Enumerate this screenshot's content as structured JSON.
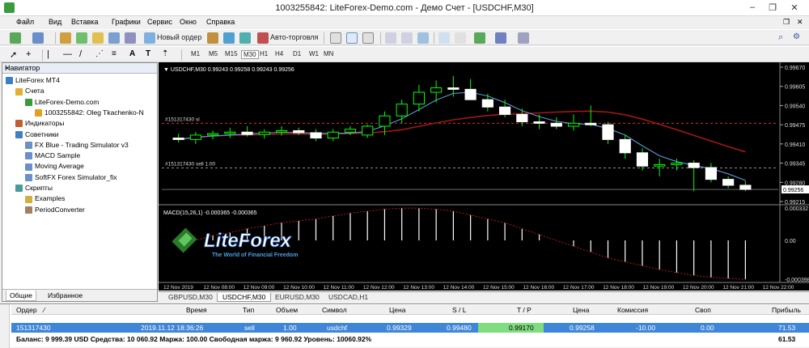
{
  "window": {
    "title": "1003255842: LiteForex-Demo.com - Демо Счет - [USDCHF,M30]",
    "buttons": [
      "–",
      "❐",
      "✕"
    ]
  },
  "menu": [
    "Файл",
    "Вид",
    "Вставка",
    "Графики",
    "Сервис",
    "Окно",
    "Справка"
  ],
  "toolbar": {
    "new_order": "Новый ордер",
    "auto_trading": "Авто-торговля",
    "timeframes": [
      "M1",
      "M5",
      "M15",
      "M30",
      "H1",
      "H4",
      "D1",
      "W1",
      "MN"
    ]
  },
  "navigator": {
    "title": "Навигатор",
    "items": [
      {
        "label": "LiteForex MT4",
        "level": 0,
        "icon": "terminal-icon"
      },
      {
        "label": "Счета",
        "level": 1,
        "icon": "accounts-icon"
      },
      {
        "label": "LiteForex-Demo.com",
        "level": 2,
        "icon": "server-icon"
      },
      {
        "label": "1003255842: Oleg Tkachenko-N",
        "level": 3,
        "icon": "user-icon"
      },
      {
        "label": "Индикаторы",
        "level": 1,
        "icon": "indicators-icon"
      },
      {
        "label": "Советники",
        "level": 1,
        "icon": "experts-icon"
      },
      {
        "label": "FX Blue - Trading Simulator v3",
        "level": 2,
        "icon": "expert-icon"
      },
      {
        "label": "MACD Sample",
        "level": 2,
        "icon": "expert-icon"
      },
      {
        "label": "Moving Average",
        "level": 2,
        "icon": "expert-icon"
      },
      {
        "label": "SoftFX Forex Simulator_fix",
        "level": 2,
        "icon": "expert-icon"
      },
      {
        "label": "Скрипты",
        "level": 1,
        "icon": "scripts-icon"
      },
      {
        "label": "Examples",
        "level": 2,
        "icon": "folder-icon"
      },
      {
        "label": "PeriodConverter",
        "level": 2,
        "icon": "script-icon"
      }
    ],
    "tabs": [
      "Общие",
      "Избранное"
    ]
  },
  "chart": {
    "header": "USDCHF,M30  0.99243 0.99258 0.99243 0.99256",
    "macd_header": "MACD(15,26,1) -0.000365 -0.000365",
    "order_label_1": "#151317430 sl",
    "order_label_2": "#151317430 sell 1.00",
    "price_ticks": [
      "0.99670",
      "0.99605",
      "0.99540",
      "0.99475",
      "0.99410",
      "0.99345",
      "0.99280",
      "0.99215"
    ],
    "current_price": "0.99256",
    "macd_ticks": [
      "0.000332",
      "0.00",
      "-0.000398"
    ],
    "time_labels": [
      "12 Nov 2019",
      "12 Nov 08:00",
      "12 Nov 09:00",
      "12 Nov 10:00",
      "12 Nov 11:00",
      "12 Nov 12:00",
      "12 Nov 13:00",
      "12 Nov 14:00",
      "12 Nov 15:00",
      "12 Nov 16:00",
      "12 Nov 17:00",
      "12 Nov 18:00",
      "12 Nov 19:00",
      "12 Nov 20:00",
      "12 Nov 21:00",
      "12 Nov 22:00"
    ],
    "logo_name": "LiteForex",
    "logo_tagline": "The World of Financial Freedom",
    "colors": {
      "bg": "#000000",
      "bull": "#ffffff",
      "bear": "#ffffff",
      "wick": "#00ff00",
      "ma_blue": "#5b9bd5",
      "ma_red": "#8b0000",
      "grid": "#444444"
    }
  },
  "chart_data": {
    "type": "candlestick",
    "ylim": [
      0.99215,
      0.9967
    ],
    "candles": [
      {
        "o": 0.9943,
        "h": 0.99445,
        "l": 0.99415,
        "c": 0.99425
      },
      {
        "o": 0.99425,
        "h": 0.9945,
        "l": 0.9941,
        "c": 0.9944
      },
      {
        "o": 0.9944,
        "h": 0.99455,
        "l": 0.99425,
        "c": 0.99445
      },
      {
        "o": 0.99445,
        "h": 0.99465,
        "l": 0.9943,
        "c": 0.9945
      },
      {
        "o": 0.9945,
        "h": 0.9947,
        "l": 0.99435,
        "c": 0.99442
      },
      {
        "o": 0.99442,
        "h": 0.9946,
        "l": 0.99428,
        "c": 0.9945
      },
      {
        "o": 0.9945,
        "h": 0.9947,
        "l": 0.99438,
        "c": 0.99455
      },
      {
        "o": 0.99455,
        "h": 0.99465,
        "l": 0.9944,
        "c": 0.99448
      },
      {
        "o": 0.99448,
        "h": 0.9946,
        "l": 0.9942,
        "c": 0.9943
      },
      {
        "o": 0.9943,
        "h": 0.9946,
        "l": 0.9942,
        "c": 0.9945
      },
      {
        "o": 0.9945,
        "h": 0.9947,
        "l": 0.9944,
        "c": 0.9946
      },
      {
        "o": 0.9944,
        "h": 0.99475,
        "l": 0.9943,
        "c": 0.9947
      },
      {
        "o": 0.9947,
        "h": 0.9952,
        "l": 0.9944,
        "c": 0.99505
      },
      {
        "o": 0.99505,
        "h": 0.9956,
        "l": 0.9948,
        "c": 0.99545
      },
      {
        "o": 0.99545,
        "h": 0.9961,
        "l": 0.9952,
        "c": 0.99585
      },
      {
        "o": 0.99585,
        "h": 0.99625,
        "l": 0.9955,
        "c": 0.996
      },
      {
        "o": 0.996,
        "h": 0.9964,
        "l": 0.9957,
        "c": 0.99595
      },
      {
        "o": 0.99595,
        "h": 0.9963,
        "l": 0.9956,
        "c": 0.9956
      },
      {
        "o": 0.9956,
        "h": 0.9958,
        "l": 0.9952,
        "c": 0.99535
      },
      {
        "o": 0.99535,
        "h": 0.9956,
        "l": 0.995,
        "c": 0.9951
      },
      {
        "o": 0.9951,
        "h": 0.9953,
        "l": 0.9947,
        "c": 0.99485
      },
      {
        "o": 0.99485,
        "h": 0.9951,
        "l": 0.9946,
        "c": 0.9948
      },
      {
        "o": 0.9948,
        "h": 0.995,
        "l": 0.9946,
        "c": 0.9947
      },
      {
        "o": 0.9947,
        "h": 0.9951,
        "l": 0.99455,
        "c": 0.9948
      },
      {
        "o": 0.9948,
        "h": 0.9954,
        "l": 0.9947,
        "c": 0.99475
      },
      {
        "o": 0.99475,
        "h": 0.99485,
        "l": 0.9941,
        "c": 0.99425
      },
      {
        "o": 0.99425,
        "h": 0.9944,
        "l": 0.9936,
        "c": 0.9938
      },
      {
        "o": 0.9938,
        "h": 0.99395,
        "l": 0.9932,
        "c": 0.99335
      },
      {
        "o": 0.99335,
        "h": 0.9936,
        "l": 0.993,
        "c": 0.9934
      },
      {
        "o": 0.9934,
        "h": 0.9936,
        "l": 0.9932,
        "c": 0.99345
      },
      {
        "o": 0.99345,
        "h": 0.99355,
        "l": 0.9925,
        "c": 0.9933
      },
      {
        "o": 0.9933,
        "h": 0.99345,
        "l": 0.9928,
        "c": 0.9929
      },
      {
        "o": 0.9929,
        "h": 0.993,
        "l": 0.9926,
        "c": 0.9927
      },
      {
        "o": 0.9927,
        "h": 0.99285,
        "l": 0.9925,
        "c": 0.99256
      }
    ],
    "macd": [
      -5e-05,
      0.0,
      5e-05,
      8e-05,
      0.00012,
      0.00015,
      0.00018,
      0.0002,
      0.00022,
      0.00025,
      0.00028,
      0.0003,
      0.00032,
      0.00033,
      0.00033,
      0.00032,
      0.0003,
      0.00026,
      0.00022,
      0.00018,
      0.00012,
      6e-05,
      0.0,
      -6e-05,
      -0.00012,
      -0.00018,
      -0.00022,
      -0.00026,
      -0.0003,
      -0.00033,
      -0.00036,
      -0.00038,
      -0.00039,
      -0.0004
    ],
    "macd_ylim": [
      -0.000398,
      0.000332
    ]
  },
  "chart_tabs": [
    "GBPUSD,M30",
    "USDCHF,M30",
    "EURUSD,M30",
    "USDCAD,H1"
  ],
  "terminal": {
    "columns": [
      "Ордер",
      "Время",
      "Тип",
      "Объем",
      "Символ",
      "Цена",
      "S / L",
      "T / P",
      "Цена",
      "Комиссия",
      "Своп",
      "Прибыль"
    ],
    "row": [
      "151317430",
      "2019.11.12 18:36:26",
      "sell",
      "1.00",
      "usdchf",
      "0.99329",
      "0.99480",
      "0.99170",
      "0.99258",
      "-10.00",
      "0.00",
      "71.53"
    ],
    "balance_line": "Баланс: 9 999.39 USD  Средства: 10 060.92  Маржа: 100.00  Свободная маржа: 9 960.92  Уровень: 10060.92%",
    "balance_total": "61.53"
  }
}
